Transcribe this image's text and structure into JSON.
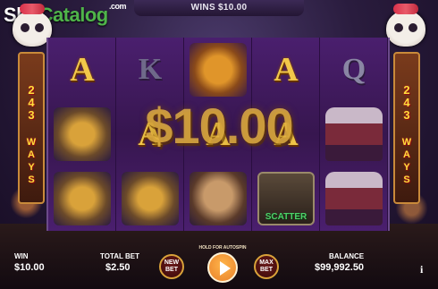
{
  "top_bar": {
    "wins_text": "WINS $10.00"
  },
  "logo": {
    "part1": "Slot",
    "part2": "Catalog",
    "suffix": ".com"
  },
  "ways": {
    "number_digits": [
      "2",
      "4",
      "3"
    ],
    "label_letters": [
      "W",
      "A",
      "Y",
      "S"
    ]
  },
  "reels": [
    {
      "symbols": [
        "A",
        "fish",
        "fish"
      ]
    },
    {
      "symbols": [
        "K",
        "A",
        "fish"
      ]
    },
    {
      "symbols": [
        "guitar",
        "A",
        "dog"
      ]
    },
    {
      "symbols": [
        "A",
        "A",
        "scatter"
      ]
    },
    {
      "symbols": [
        "Q",
        "cake",
        "cake"
      ]
    }
  ],
  "scatter_label": "SCATTER",
  "win_display": "$10.00",
  "hud": {
    "win_label": "WIN",
    "win_value": "$10.00",
    "total_bet_label": "TOTAL BET",
    "total_bet_value": "$2.50",
    "new_bet_label": "NEW BET",
    "max_bet_label": "MAX BET",
    "autoplay_hint": "HOLD FOR AUTOSPIN",
    "balance_label": "BALANCE",
    "balance_value": "$99,992.50",
    "info_label": "i"
  },
  "colors": {
    "gold": "#f2c84a",
    "reel_purple": "#4a1f6e",
    "brand_green": "#4fb44a",
    "spin_orange": "#e8802a"
  }
}
